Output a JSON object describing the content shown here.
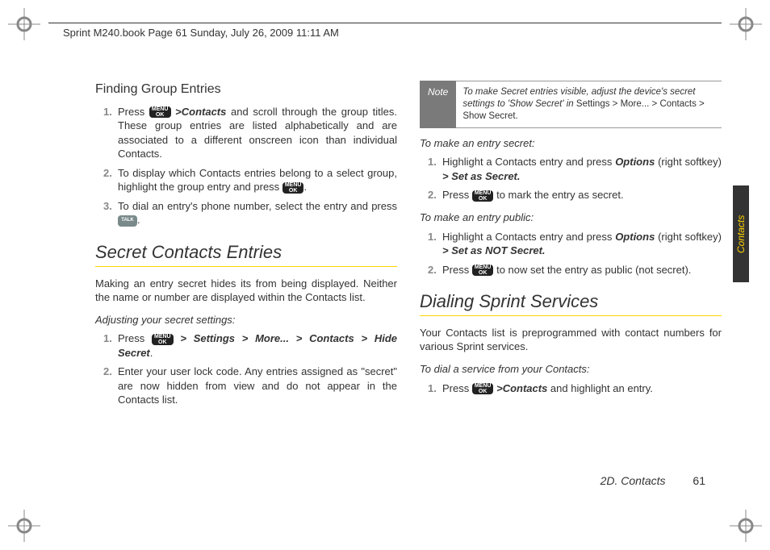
{
  "header": {
    "bookline": "Sprint M240.book  Page 61  Sunday, July 26, 2009  11:11 AM"
  },
  "left": {
    "h3": "Finding Group Entries",
    "li1a": "Press ",
    "li1b": " >",
    "li1c": "Contacts",
    "li1d": " and scroll through the group titles. These group entries are listed alphabetically and are associated to a different onscreen icon than individual Contacts.",
    "li2a": "To display which Contacts entries belong to a select group, highlight the group entry and press ",
    "li2b": ".",
    "li3a": "To dial an entry's phone number, select the entry and press ",
    "li3b": ".",
    "h2": "Secret Contacts Entries",
    "p1": "Making an entry secret hides its from being displayed. Neither the name or number are displayed within the Contacts list.",
    "sub1": "Adjusting your secret settings:",
    "s1a": "Press ",
    "s1b": " > ",
    "s1c": "Settings",
    "s1d": " > ",
    "s1e": "More...",
    "s1f": " > ",
    "s1g": "Contacts",
    "s1h": " > ",
    "s1i": "Hide Secret",
    "s1j": ".",
    "s2": "Enter your user lock code. Any entries assigned as \"secret\" are now hidden from view and do not appear in the Contacts list."
  },
  "right": {
    "note_label": "Note",
    "note_a": "To make Secret entries visible, adjust the device's secret settings to 'Show Secret' in ",
    "note_b": "Settings > More... > Contacts > Show Secret",
    "note_c": ".",
    "sub1": "To make an entry secret:",
    "r1a": "Highlight a Contacts entry and press ",
    "r1b": "Options",
    "r1c": " (right softkey) ",
    "r1d": "> ",
    "r1e": "Set as Secret.",
    "r2a": "Press ",
    "r2b": " to mark the entry as secret.",
    "sub2": "To make an entry public:",
    "p1a": "Highlight a Contacts entry and press ",
    "p1b": "Options",
    "p1c": " (right softkey) ",
    "p1d": "> ",
    "p1e": "Set as NOT Secret.",
    "p2a": "Press ",
    "p2b": " to now set the entry as public (not secret).",
    "h2": "Dialing Sprint Services",
    "dp": "Your Contacts list is preprogrammed with contact numbers for various Sprint services.",
    "sub3": "To dial a service from your Contacts:",
    "d1a": "Press ",
    "d1b": " >",
    "d1c": "Contacts",
    "d1d": " and highlight an entry."
  },
  "footer": {
    "section": "2D. Contacts",
    "page": "61"
  },
  "tab": "Contacts",
  "keys": {
    "menu": "MENU\nOK",
    "talk": "TALK"
  },
  "nums": {
    "n1": "1.",
    "n2": "2.",
    "n3": "3."
  }
}
